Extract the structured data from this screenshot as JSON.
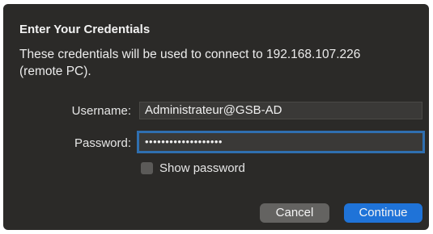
{
  "dialog": {
    "title": "Enter Your Credentials",
    "message_line1": "These credentials will be used to connect to 192.168.107.226",
    "message_line2": "(remote PC).",
    "username_label": "Username:",
    "username_value": "Administrateur@GSB-AD",
    "password_label": "Password:",
    "password_value": "•••••••••••••••••••",
    "show_password_label": "Show password",
    "show_password_checked": false,
    "cancel_label": "Cancel",
    "continue_label": "Continue"
  },
  "colors": {
    "background": "#2b2a28",
    "focus_ring": "#2f6fb0",
    "primary_button": "#1f73d8",
    "secondary_button": "#646361"
  }
}
